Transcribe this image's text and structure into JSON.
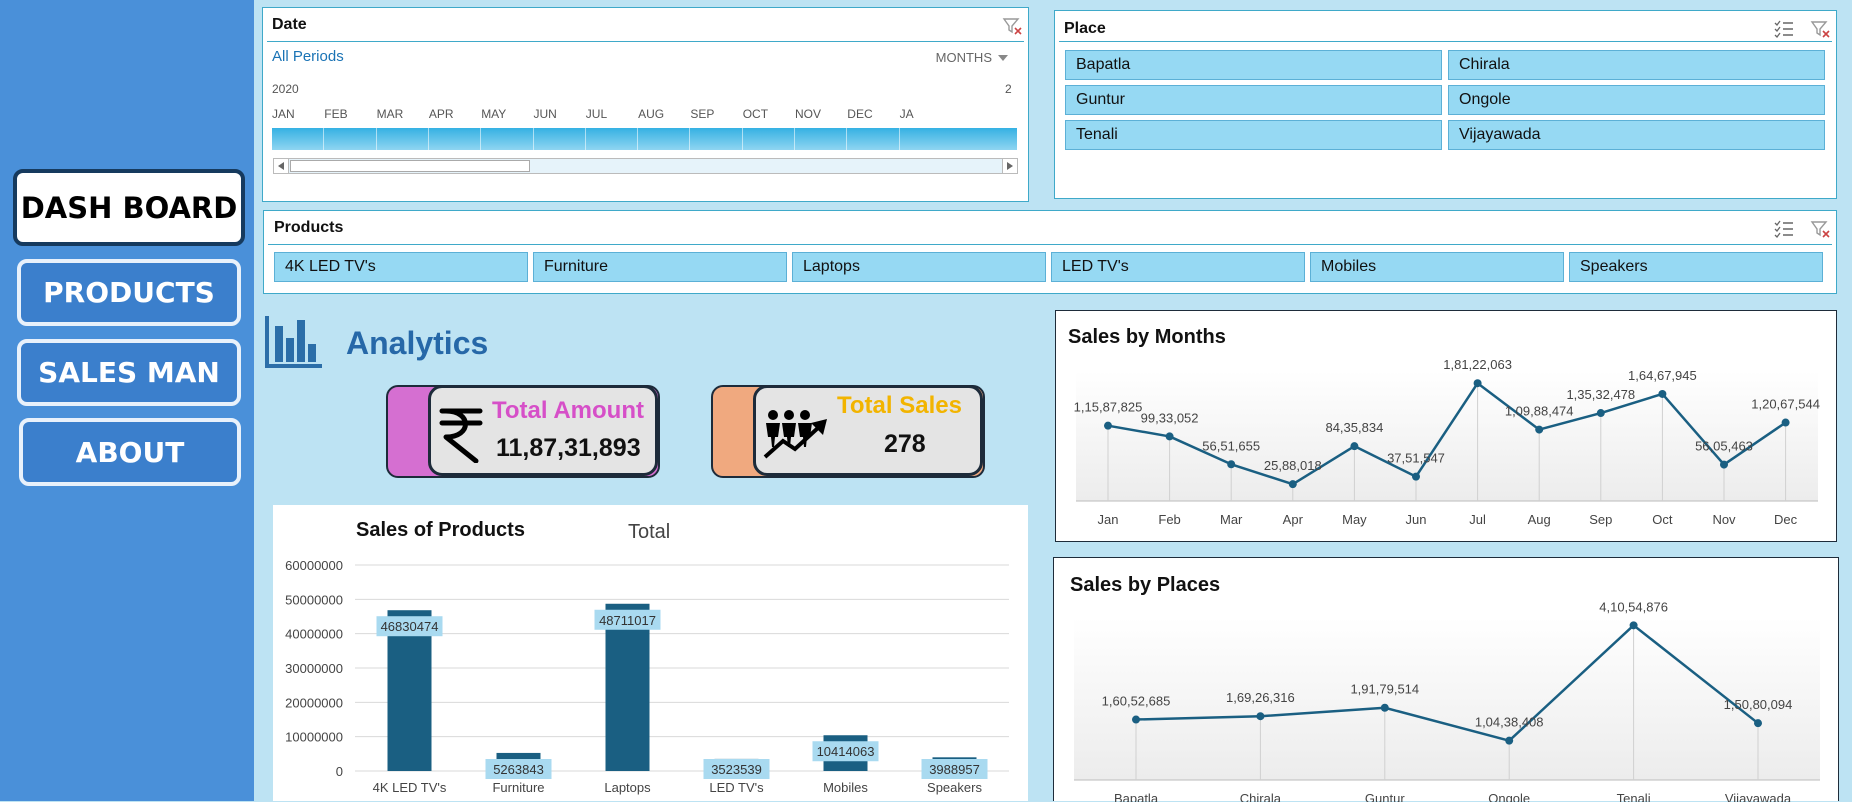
{
  "nav": {
    "items": [
      {
        "label": "DASH BOARD",
        "active": true
      },
      {
        "label": "PRODUCTS"
      },
      {
        "label": "SALES MAN"
      },
      {
        "label": "ABOUT"
      }
    ]
  },
  "date_slicer": {
    "title": "Date",
    "all_periods": "All Periods",
    "period_unit": "MONTHS",
    "year_start": "2020",
    "year_next": "2",
    "months": [
      "JAN",
      "FEB",
      "MAR",
      "APR",
      "MAY",
      "JUN",
      "JUL",
      "AUG",
      "SEP",
      "OCT",
      "NOV",
      "DEC",
      "JA"
    ]
  },
  "place_slicer": {
    "title": "Place",
    "items": [
      "Bapatla",
      "Chirala",
      "Guntur",
      "Ongole",
      "Tenali",
      "Vijayawada"
    ]
  },
  "products_slicer": {
    "title": "Products",
    "items": [
      "4K LED TV's",
      "Furniture",
      "Laptops",
      "LED TV's",
      "Mobiles",
      "Speakers"
    ]
  },
  "analytics": {
    "title": "Analytics",
    "kpis": [
      {
        "label": "Total Amount",
        "value": "11,87,31,893",
        "label_color": "#d64fc8",
        "accent": "#d56fd1",
        "icon": "rupee-icon"
      },
      {
        "label": "Total Sales",
        "value": "278",
        "label_color": "#f2b400",
        "accent": "#f0a97f",
        "icon": "people-growth-icon"
      }
    ]
  },
  "colors": {
    "series": "#1a5f82",
    "label_bg": "#a9daf0"
  },
  "chart_data": [
    {
      "type": "bar",
      "title": "Sales of Products",
      "legend": "Total",
      "categories": [
        "4K LED TV's",
        "Furniture",
        "Laptops",
        "LED TV's",
        "Mobiles",
        "Speakers"
      ],
      "values": [
        46830474,
        5263843,
        48711017,
        3523539,
        10414063,
        3988957
      ],
      "y_ticks": [
        "0",
        "10000000",
        "20000000",
        "30000000",
        "40000000",
        "50000000",
        "60000000"
      ],
      "ylim": [
        0,
        60000000
      ]
    },
    {
      "type": "line",
      "title": "Sales by Months",
      "categories": [
        "Jan",
        "Feb",
        "Mar",
        "Apr",
        "May",
        "Jun",
        "Jul",
        "Aug",
        "Sep",
        "Oct",
        "Nov",
        "Dec"
      ],
      "values": [
        11587825,
        9933052,
        5651655,
        2588018,
        8435834,
        3751547,
        18122063,
        10988474,
        13532478,
        16467945,
        5605463,
        12067544
      ],
      "labels": [
        "1,15,87,825",
        "99,33,052",
        "56,51,655",
        "25,88,018",
        "84,35,834",
        "37,51,547",
        "1,81,22,063",
        "1,09,88,474",
        "1,35,32,478",
        "1,64,67,945",
        "56,05,463",
        "1,20,67,544"
      ]
    },
    {
      "type": "line",
      "title": "Sales by Places",
      "categories": [
        "Bapatla",
        "Chirala",
        "Guntur",
        "Ongole",
        "Tenali",
        "Vijayawada"
      ],
      "values": [
        16052685,
        16926316,
        19179514,
        10438408,
        41054876,
        15080094
      ],
      "labels": [
        "1,60,52,685",
        "1,69,26,316",
        "1,91,79,514",
        "1,04,38,408",
        "4,10,54,876",
        "1,50,80,094"
      ]
    }
  ]
}
